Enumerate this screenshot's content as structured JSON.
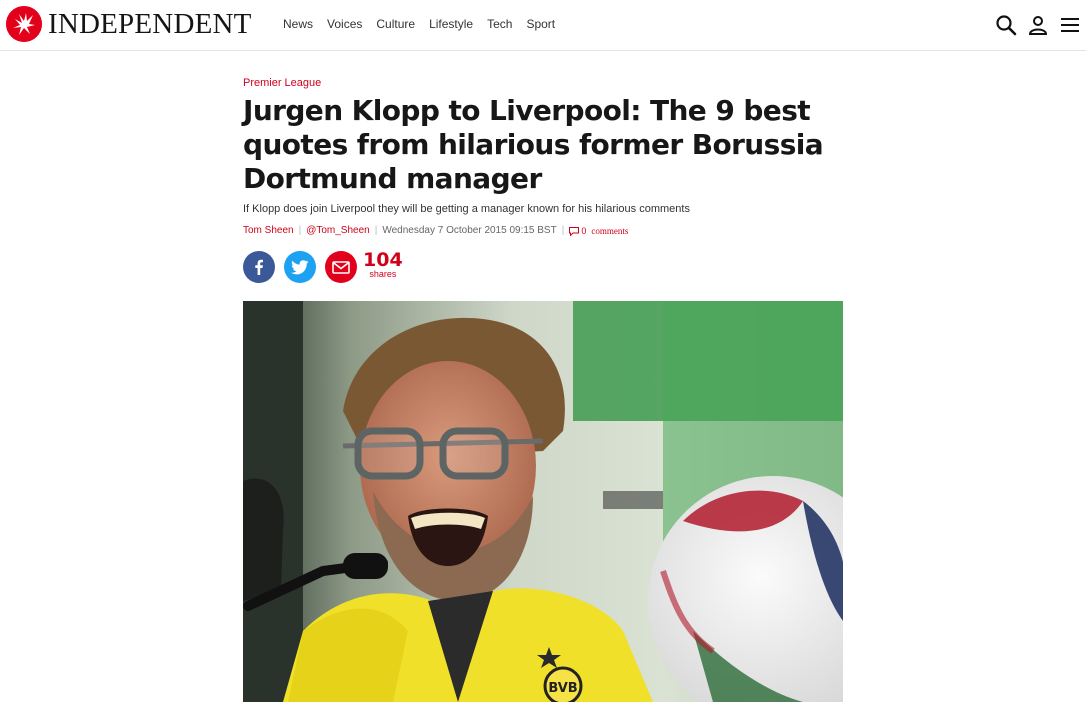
{
  "header": {
    "logo_text": "INDEPENDENT",
    "nav": [
      "News",
      "Voices",
      "Culture",
      "Lifestyle",
      "Tech",
      "Sport"
    ],
    "icons": [
      "search-icon",
      "user-icon",
      "menu-icon"
    ]
  },
  "article": {
    "category": "Premier League",
    "headline": "Jurgen Klopp to Liverpool: The 9 best quotes from hilarious former Borussia Dortmund manager",
    "standfirst": "If Klopp does join Liverpool they will be getting a manager known for his hilarious comments",
    "byline": {
      "author": "Tom Sheen",
      "handle": "@Tom_Sheen",
      "date": "Wednesday 7 October 2015 09:15 BST",
      "comment_count": "0",
      "comments_label": "comments"
    },
    "share": {
      "count": "104",
      "label": "shares"
    },
    "hero_image": "photo of a laughing man with glasses in a yellow jacket at a press conference microphone, football in foreground"
  },
  "colors": {
    "brand_red": "#e3001b",
    "link_red": "#d0021b",
    "facebook": "#3b5998",
    "twitter": "#1da1f2"
  }
}
